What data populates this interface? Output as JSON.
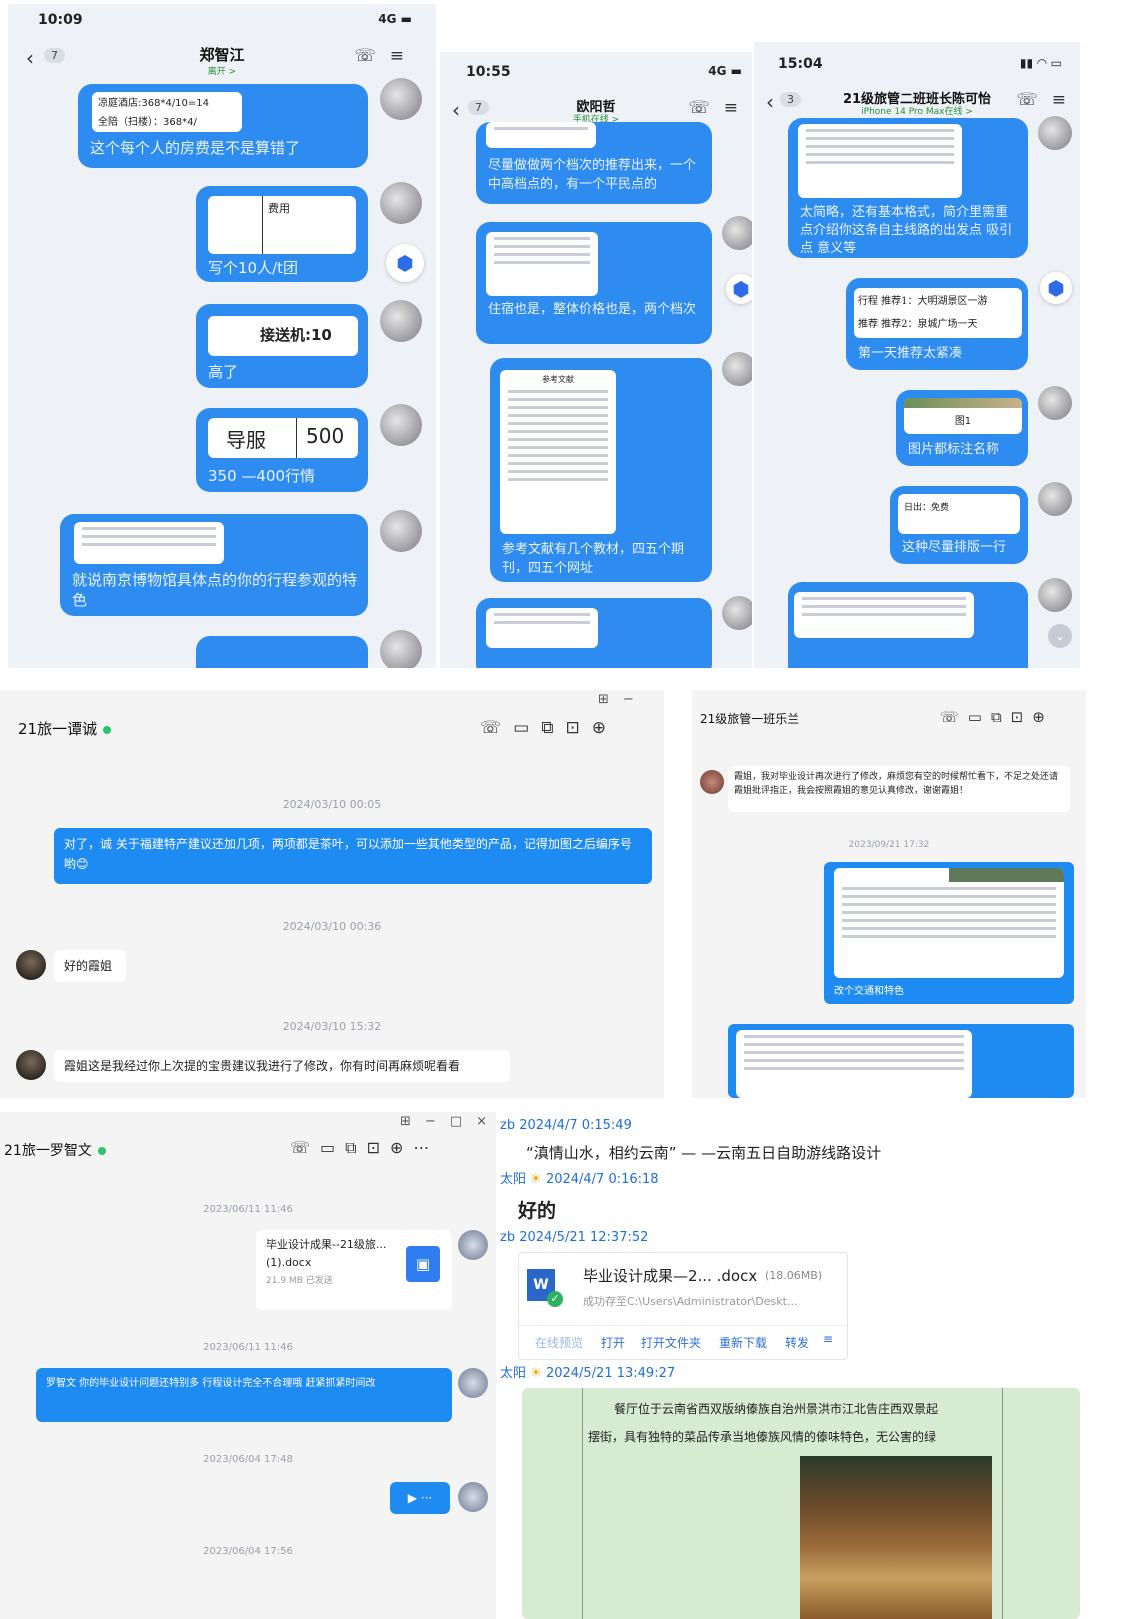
{
  "p1": {
    "time": "10:09",
    "signal": "4G",
    "back_count": "7",
    "contact": "郑智江",
    "contact_sub": "离开 >",
    "msgs": [
      {
        "doc_l1": "凉庭酒店:368*4/10=14",
        "doc_l2": "全陪（扫楼）：368*4/",
        "text": "这个每个人的房费是不是算错了"
      },
      {
        "doc_hdr": "费用",
        "text": "写个10人/t团"
      },
      {
        "doc_l1": "接送机:10",
        "text": "高了"
      },
      {
        "doc_c1": "导服",
        "doc_c2": "500",
        "text": "350 —400行情"
      },
      {
        "text": "就说南京博物馆具体点的你的行程参观的特色"
      }
    ]
  },
  "p2": {
    "time": "10:55",
    "signal": "4G",
    "back_count": "7",
    "contact": "欧阳哲",
    "contact_sub": "手机在线 >",
    "msgs": [
      {
        "text": "尽量做做两个档次的推荐出来，一个中高档点的，有一个平民点的"
      },
      {
        "text": "住宿也是，整体价格也是，两个档次"
      },
      {
        "doc_title": "参考文献",
        "text": "参考文献有几个教材，四五个期刊，四五个网址"
      }
    ]
  },
  "p3": {
    "time": "15:04",
    "back_count": "3",
    "contact": "21级旅管二班班长陈可怡",
    "contact_sub": "iPhone 14 Pro Max在线 >",
    "msgs": [
      {
        "text": "太简略，还有基本格式，简介里需重点介绍你这条自主线路的出发点 吸引点 意义等"
      },
      {
        "doc_l1": "行程   推荐1：大明湖景区一游",
        "doc_l2": "推荐   推荐2：泉城广场一天",
        "text": "第一天推荐太紧凑"
      },
      {
        "doc_l1": "图1",
        "text": "图片都标注名称"
      },
      {
        "doc_l1": "日出：免费",
        "text": "这种尽量排版一行"
      }
    ]
  },
  "d1": {
    "title": "21旅一谭诚",
    "messages": [
      {
        "ts": "2024/03/10 00:05"
      },
      {
        "text": "对了，诚  关于福建特产建议还加几项，两项都是茶叶，可以添加一些其他类型的产品，记得加图之后编序号哟😊"
      },
      {
        "ts": "2024/03/10 00:36"
      },
      {
        "text": "好的霞姐"
      },
      {
        "ts": "2024/03/10 15:32"
      },
      {
        "text": "霞姐这是我经过你上次提的宝贵建议我进行了修改，你有时间再麻烦呢看看"
      }
    ]
  },
  "d2": {
    "title": "21级旅管一班乐兰",
    "text1": "霞姐，我对毕业设计再次进行了修改，麻烦您有空的时候帮忙看下，不足之处还请霞姐批评指正，我会按照霞姐的意见认真修改，谢谢霞姐！",
    "ts1": "2023/09/21 17:32",
    "caption": "改个交通和特色"
  },
  "d3": {
    "title": "21旅一罗智文",
    "ts1": "2023/06/11 11:46",
    "file_name": "毕业设计成果--21级旅...",
    "file_name2": "(1).docx",
    "file_meta": "21.9 MB  已发送",
    "ts2": "2023/06/11 11:46",
    "text": "罗智文  你的毕业设计问题还特别多  行程设计完全不合理哦  赶紧抓紧时间改",
    "ts3": "2023/06/04 17:48",
    "voice": "▶ ···",
    "ts4": "2023/06/04 17:56"
  },
  "qq": {
    "m1_sender": "zb 2024/4/7 0:15:49",
    "m1_text": "“滇情山水，相约云南”  — —云南五日自助游线路设计",
    "m2_sender": "太阳",
    "m2_time": "2024/4/7 0:16:18",
    "m2_text": "好的",
    "m3_sender": "zb 2024/5/21 12:37:52",
    "file_title": "毕业设计成果—2... .docx",
    "file_size": "(18.06MB)",
    "file_status": "成功存至C:\\Users\\Administrator\\Deskt...",
    "file_actions": [
      "在线预览",
      "打开",
      "打开文件夹",
      "重新下载",
      "转发"
    ],
    "m4_sender": "太阳",
    "m4_time": "2024/5/21 13:49:27",
    "doc_text1": "餐厅位于云南省西双版纳傣族自治州景洪市江北告庄西双景起",
    "doc_text2": "摆街，具有独特的菜品传承当地傣族风情的傣味特色，无公害的绿"
  }
}
